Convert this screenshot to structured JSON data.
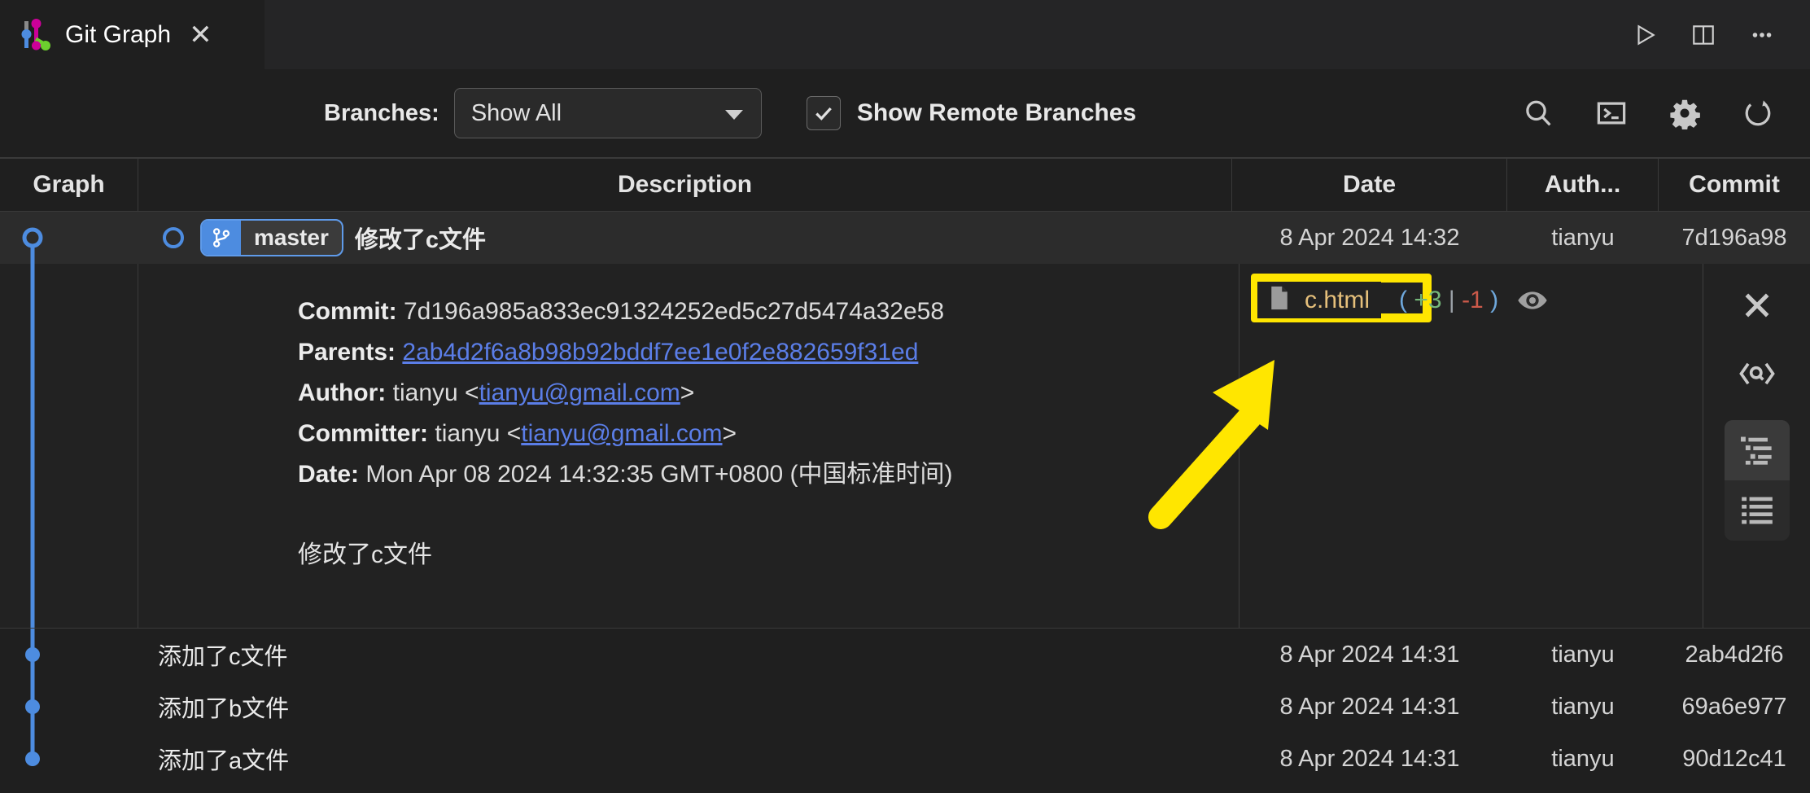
{
  "tab": {
    "title": "Git Graph",
    "close_label": "✕",
    "icon": "git-graph-logo"
  },
  "tabbar_actions": [
    {
      "name": "run-icon",
      "label": "Run"
    },
    {
      "name": "split-editor-icon",
      "label": "Split Editor"
    },
    {
      "name": "more-actions-icon",
      "label": "More Actions..."
    }
  ],
  "toolbar": {
    "branches_label": "Branches:",
    "branches_value": "Show All",
    "branches_options": [
      "Show All"
    ],
    "show_remote_label": "Show Remote Branches",
    "show_remote_checked": true,
    "actions": [
      {
        "name": "search-icon",
        "label": "Find"
      },
      {
        "name": "terminal-icon",
        "label": "Open Terminal"
      },
      {
        "name": "gear-icon",
        "label": "Repository Settings"
      },
      {
        "name": "refresh-icon",
        "label": "Refresh"
      }
    ]
  },
  "table": {
    "columns": [
      "Graph",
      "Description",
      "Date",
      "Auth...",
      "Commit"
    ],
    "rows": [
      {
        "message": "修改了c文件",
        "branch": "master",
        "date": "8 Apr 2024 14:32",
        "author": "tianyu",
        "commit": "7d196a98",
        "selected": true
      },
      {
        "message": "添加了c文件",
        "branch": "",
        "date": "8 Apr 2024 14:31",
        "author": "tianyu",
        "commit": "2ab4d2f6",
        "selected": false
      },
      {
        "message": "添加了b文件",
        "branch": "",
        "date": "8 Apr 2024 14:31",
        "author": "tianyu",
        "commit": "69a6e977",
        "selected": false
      },
      {
        "message": "添加了a文件",
        "branch": "",
        "date": "8 Apr 2024 14:31",
        "author": "tianyu",
        "commit": "90d12c41",
        "selected": false
      }
    ]
  },
  "detail": {
    "commit_label": "Commit:",
    "commit_value": "7d196a985a833ec91324252ed5c27d5474a32e58",
    "parents_label": "Parents:",
    "parents_value": "2ab4d2f6a8b98b92bddf7ee1e0f2e882659f31ed",
    "author_label": "Author:",
    "author_name": "tianyu",
    "author_email_open": "<",
    "author_email": "tianyu@gmail.com",
    "author_email_close": ">",
    "committer_label": "Committer:",
    "committer_name": "tianyu",
    "committer_email": "tianyu@gmail.com",
    "date_label": "Date:",
    "date_value": "Mon Apr 08 2024 14:32:35 GMT+0800 (中国标准时间)",
    "body": "修改了c文件",
    "files": [
      {
        "name": "c.html",
        "icon": "file-icon",
        "open_paren": "(",
        "additions": "+3",
        "separator": "|",
        "deletions": "-1",
        "close_paren": ")",
        "highlighted": true
      }
    ],
    "side_actions": [
      {
        "name": "close-icon",
        "label": "Close"
      },
      {
        "name": "code-review-icon",
        "label": "Code Review"
      },
      {
        "name": "file-tree-icon",
        "label": "File Tree View",
        "active": true
      },
      {
        "name": "file-list-icon",
        "label": "File List View",
        "active": false
      }
    ]
  },
  "annotation": {
    "arrow": "yellow-arrow-pointing-to-file",
    "highlight_color": "#ffe600"
  },
  "colors": {
    "graph_branch": "#4d8ce0",
    "accent_link": "#5b7ee8",
    "additions": "#75b87a",
    "deletions": "#cc5a4a",
    "highlight": "#ffe600"
  }
}
